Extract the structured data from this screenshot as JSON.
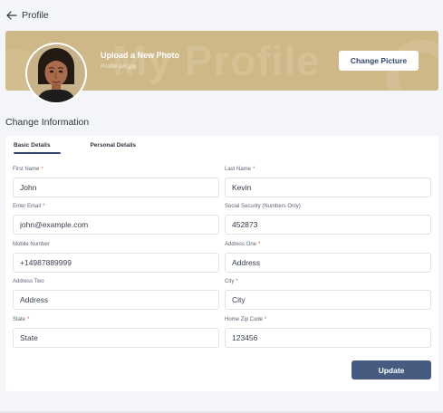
{
  "header": {
    "title": "Profile"
  },
  "banner": {
    "watermark": "My Profile",
    "upload_title": "Upload a New Photo",
    "upload_file": "Profile-pic.jpg",
    "change_button": "Change Picture",
    "background_color": "#cfb887"
  },
  "section": {
    "title": "Change Information"
  },
  "tabs": [
    {
      "label": "Basic Details",
      "active": true
    },
    {
      "label": "Personal Details",
      "active": false
    }
  ],
  "fields": {
    "first_name": {
      "label": "First Name",
      "required": "*",
      "value": "John",
      "placeholder": ""
    },
    "last_name": {
      "label": "Last Name",
      "required": "*",
      "value": "Kevin",
      "placeholder": ""
    },
    "email": {
      "label": "Enter Email",
      "required": "*",
      "value": "",
      "placeholder": "john@example.com"
    },
    "ssn": {
      "label": "Social Security (Numbers Only)",
      "required": "",
      "value": "452873",
      "placeholder": ""
    },
    "mobile": {
      "label": "Mobile Number",
      "required": "",
      "value": "",
      "placeholder": "+14987889999"
    },
    "address_one": {
      "label": "Address One",
      "required": "*",
      "value": "",
      "placeholder": "Address"
    },
    "address_two": {
      "label": "Address Two",
      "required": "",
      "value": "",
      "placeholder": "Address"
    },
    "city": {
      "label": "City",
      "required": "*",
      "value": "",
      "placeholder": "City"
    },
    "state": {
      "label": "State",
      "required": "*",
      "value": "",
      "placeholder": "State"
    },
    "zip": {
      "label": "Home Zip Code",
      "required": "*",
      "value": "",
      "placeholder": "123456"
    }
  },
  "actions": {
    "update_label": "Update",
    "update_color": "#475b80"
  },
  "icons": {
    "back": "arrow-left-icon",
    "avatar": "user-avatar-photo"
  }
}
